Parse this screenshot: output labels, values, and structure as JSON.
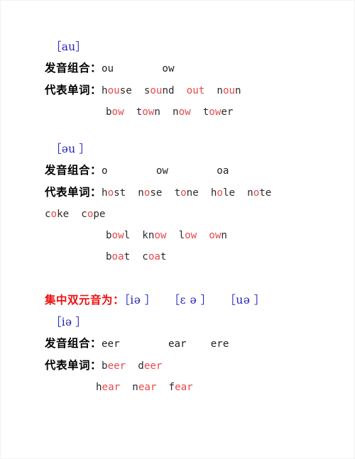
{
  "document": {
    "title": "English Diphthongs Study Notes",
    "colors": {
      "ipa_blue": "#2222bb",
      "highlight_red": "#e8484a",
      "heading_red": "#ee1111",
      "body_black": "#2b2b2b",
      "page_background": "#ffffff"
    },
    "labels": {
      "spelling_combination": "发音组合：",
      "example_words": "代表单词："
    },
    "sections": [
      {
        "id": "au",
        "ipa": "［au］",
        "combination_line": "ou        ow",
        "word_lines": [
          {
            "indent": "label",
            "words": [
              {
                "pre": "h",
                "mid": "ou",
                "post": "se"
              },
              {
                "pre": "s",
                "mid": "ou",
                "post": "nd"
              },
              {
                "pre": "",
                "mid": "out",
                "post": ""
              },
              {
                "pre": "n",
                "mid": "ou",
                "post": "n"
              }
            ]
          },
          {
            "indent": "continue",
            "words": [
              {
                "pre": "b",
                "mid": "ow",
                "post": ""
              },
              {
                "pre": "t",
                "mid": "ow",
                "post": "n"
              },
              {
                "pre": "n",
                "mid": "ow",
                "post": ""
              },
              {
                "pre": "t",
                "mid": "ow",
                "post": "er"
              }
            ]
          }
        ]
      },
      {
        "id": "eu",
        "ipa": "［əu ］",
        "combination_line": "o        ow        oa",
        "word_lines": [
          {
            "indent": "label",
            "words": [
              {
                "pre": "h",
                "mid": "o",
                "post": "st"
              },
              {
                "pre": "n",
                "mid": "o",
                "post": "se"
              },
              {
                "pre": "t",
                "mid": "o",
                "post": "ne"
              },
              {
                "pre": "h",
                "mid": "o",
                "post": "le"
              },
              {
                "pre": "n",
                "mid": "o",
                "post": "te"
              }
            ]
          },
          {
            "indent": "flush",
            "words": [
              {
                "pre": "c",
                "mid": "o",
                "post": "ke"
              },
              {
                "pre": "c",
                "mid": "o",
                "post": "pe"
              }
            ]
          },
          {
            "indent": "continue",
            "words": [
              {
                "pre": "b",
                "mid": "ow",
                "post": "l"
              },
              {
                "pre": "kn",
                "mid": "ow",
                "post": ""
              },
              {
                "pre": "l",
                "mid": "ow",
                "post": ""
              },
              {
                "pre": "",
                "mid": "ow",
                "post": "n"
              }
            ]
          },
          {
            "indent": "continue",
            "words": [
              {
                "pre": "b",
                "mid": "oa",
                "post": "t"
              },
              {
                "pre": "c",
                "mid": "oa",
                "post": "t"
              }
            ]
          }
        ]
      }
    ],
    "centering_heading": {
      "text": "集中双元音为：",
      "symbols": [
        "［iə ］",
        "［ɛ ə ］",
        "［uə ］"
      ]
    },
    "section_ie": {
      "id": "ie",
      "ipa": "［iə ］",
      "combination_line": "eer        ear    ere",
      "word_lines": [
        {
          "indent": "label",
          "words": [
            {
              "pre": "b",
              "mid": "eer",
              "post": ""
            },
            {
              "pre": "d",
              "mid": "eer",
              "post": ""
            }
          ]
        },
        {
          "indent": "continue-short",
          "words": [
            {
              "pre": "h",
              "mid": "ear",
              "post": ""
            },
            {
              "pre": "n",
              "mid": "ear",
              "post": ""
            },
            {
              "pre": "f",
              "mid": "ear",
              "post": ""
            }
          ]
        }
      ]
    }
  }
}
